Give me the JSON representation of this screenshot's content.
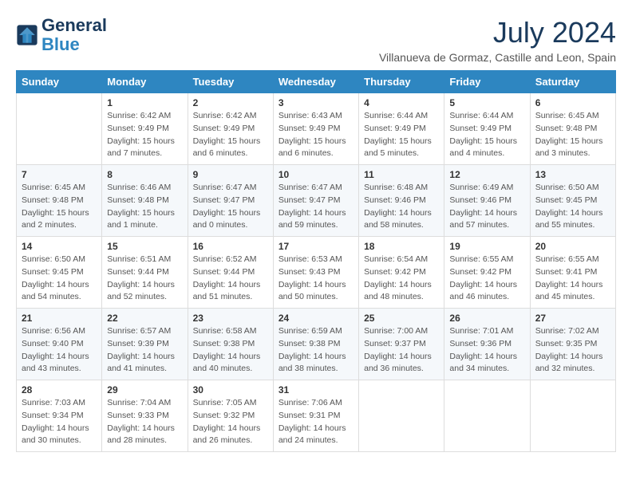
{
  "logo": {
    "line1": "General",
    "line2": "Blue"
  },
  "title": "July 2024",
  "location": "Villanueva de Gormaz, Castille and Leon, Spain",
  "weekdays": [
    "Sunday",
    "Monday",
    "Tuesday",
    "Wednesday",
    "Thursday",
    "Friday",
    "Saturday"
  ],
  "weeks": [
    [
      {
        "day": "",
        "sunrise": "",
        "sunset": "",
        "daylight": ""
      },
      {
        "day": "1",
        "sunrise": "Sunrise: 6:42 AM",
        "sunset": "Sunset: 9:49 PM",
        "daylight": "Daylight: 15 hours and 7 minutes."
      },
      {
        "day": "2",
        "sunrise": "Sunrise: 6:42 AM",
        "sunset": "Sunset: 9:49 PM",
        "daylight": "Daylight: 15 hours and 6 minutes."
      },
      {
        "day": "3",
        "sunrise": "Sunrise: 6:43 AM",
        "sunset": "Sunset: 9:49 PM",
        "daylight": "Daylight: 15 hours and 6 minutes."
      },
      {
        "day": "4",
        "sunrise": "Sunrise: 6:44 AM",
        "sunset": "Sunset: 9:49 PM",
        "daylight": "Daylight: 15 hours and 5 minutes."
      },
      {
        "day": "5",
        "sunrise": "Sunrise: 6:44 AM",
        "sunset": "Sunset: 9:49 PM",
        "daylight": "Daylight: 15 hours and 4 minutes."
      },
      {
        "day": "6",
        "sunrise": "Sunrise: 6:45 AM",
        "sunset": "Sunset: 9:48 PM",
        "daylight": "Daylight: 15 hours and 3 minutes."
      }
    ],
    [
      {
        "day": "7",
        "sunrise": "Sunrise: 6:45 AM",
        "sunset": "Sunset: 9:48 PM",
        "daylight": "Daylight: 15 hours and 2 minutes."
      },
      {
        "day": "8",
        "sunrise": "Sunrise: 6:46 AM",
        "sunset": "Sunset: 9:48 PM",
        "daylight": "Daylight: 15 hours and 1 minute."
      },
      {
        "day": "9",
        "sunrise": "Sunrise: 6:47 AM",
        "sunset": "Sunset: 9:47 PM",
        "daylight": "Daylight: 15 hours and 0 minutes."
      },
      {
        "day": "10",
        "sunrise": "Sunrise: 6:47 AM",
        "sunset": "Sunset: 9:47 PM",
        "daylight": "Daylight: 14 hours and 59 minutes."
      },
      {
        "day": "11",
        "sunrise": "Sunrise: 6:48 AM",
        "sunset": "Sunset: 9:46 PM",
        "daylight": "Daylight: 14 hours and 58 minutes."
      },
      {
        "day": "12",
        "sunrise": "Sunrise: 6:49 AM",
        "sunset": "Sunset: 9:46 PM",
        "daylight": "Daylight: 14 hours and 57 minutes."
      },
      {
        "day": "13",
        "sunrise": "Sunrise: 6:50 AM",
        "sunset": "Sunset: 9:45 PM",
        "daylight": "Daylight: 14 hours and 55 minutes."
      }
    ],
    [
      {
        "day": "14",
        "sunrise": "Sunrise: 6:50 AM",
        "sunset": "Sunset: 9:45 PM",
        "daylight": "Daylight: 14 hours and 54 minutes."
      },
      {
        "day": "15",
        "sunrise": "Sunrise: 6:51 AM",
        "sunset": "Sunset: 9:44 PM",
        "daylight": "Daylight: 14 hours and 52 minutes."
      },
      {
        "day": "16",
        "sunrise": "Sunrise: 6:52 AM",
        "sunset": "Sunset: 9:44 PM",
        "daylight": "Daylight: 14 hours and 51 minutes."
      },
      {
        "day": "17",
        "sunrise": "Sunrise: 6:53 AM",
        "sunset": "Sunset: 9:43 PM",
        "daylight": "Daylight: 14 hours and 50 minutes."
      },
      {
        "day": "18",
        "sunrise": "Sunrise: 6:54 AM",
        "sunset": "Sunset: 9:42 PM",
        "daylight": "Daylight: 14 hours and 48 minutes."
      },
      {
        "day": "19",
        "sunrise": "Sunrise: 6:55 AM",
        "sunset": "Sunset: 9:42 PM",
        "daylight": "Daylight: 14 hours and 46 minutes."
      },
      {
        "day": "20",
        "sunrise": "Sunrise: 6:55 AM",
        "sunset": "Sunset: 9:41 PM",
        "daylight": "Daylight: 14 hours and 45 minutes."
      }
    ],
    [
      {
        "day": "21",
        "sunrise": "Sunrise: 6:56 AM",
        "sunset": "Sunset: 9:40 PM",
        "daylight": "Daylight: 14 hours and 43 minutes."
      },
      {
        "day": "22",
        "sunrise": "Sunrise: 6:57 AM",
        "sunset": "Sunset: 9:39 PM",
        "daylight": "Daylight: 14 hours and 41 minutes."
      },
      {
        "day": "23",
        "sunrise": "Sunrise: 6:58 AM",
        "sunset": "Sunset: 9:38 PM",
        "daylight": "Daylight: 14 hours and 40 minutes."
      },
      {
        "day": "24",
        "sunrise": "Sunrise: 6:59 AM",
        "sunset": "Sunset: 9:38 PM",
        "daylight": "Daylight: 14 hours and 38 minutes."
      },
      {
        "day": "25",
        "sunrise": "Sunrise: 7:00 AM",
        "sunset": "Sunset: 9:37 PM",
        "daylight": "Daylight: 14 hours and 36 minutes."
      },
      {
        "day": "26",
        "sunrise": "Sunrise: 7:01 AM",
        "sunset": "Sunset: 9:36 PM",
        "daylight": "Daylight: 14 hours and 34 minutes."
      },
      {
        "day": "27",
        "sunrise": "Sunrise: 7:02 AM",
        "sunset": "Sunset: 9:35 PM",
        "daylight": "Daylight: 14 hours and 32 minutes."
      }
    ],
    [
      {
        "day": "28",
        "sunrise": "Sunrise: 7:03 AM",
        "sunset": "Sunset: 9:34 PM",
        "daylight": "Daylight: 14 hours and 30 minutes."
      },
      {
        "day": "29",
        "sunrise": "Sunrise: 7:04 AM",
        "sunset": "Sunset: 9:33 PM",
        "daylight": "Daylight: 14 hours and 28 minutes."
      },
      {
        "day": "30",
        "sunrise": "Sunrise: 7:05 AM",
        "sunset": "Sunset: 9:32 PM",
        "daylight": "Daylight: 14 hours and 26 minutes."
      },
      {
        "day": "31",
        "sunrise": "Sunrise: 7:06 AM",
        "sunset": "Sunset: 9:31 PM",
        "daylight": "Daylight: 14 hours and 24 minutes."
      },
      {
        "day": "",
        "sunrise": "",
        "sunset": "",
        "daylight": ""
      },
      {
        "day": "",
        "sunrise": "",
        "sunset": "",
        "daylight": ""
      },
      {
        "day": "",
        "sunrise": "",
        "sunset": "",
        "daylight": ""
      }
    ]
  ],
  "colors": {
    "header_bg": "#2e86c1",
    "header_text": "#ffffff",
    "title_color": "#1a3a5c",
    "cell_text": "#555555"
  }
}
